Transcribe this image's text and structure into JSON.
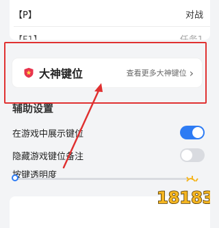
{
  "top_rows": [
    {
      "left": "【P】",
      "right": "对战"
    },
    {
      "left": "【F1】",
      "right": "任务1"
    }
  ],
  "master_keys": {
    "title": "大神键位",
    "link": "查看更多大神键位",
    "chevron": "›"
  },
  "section": {
    "title": "辅助设置"
  },
  "settings": [
    {
      "label": "在游戏中展示键位",
      "state": "on"
    },
    {
      "label": "隐藏游戏键位备注",
      "state": "off"
    }
  ],
  "opacity": {
    "label": "按键透明度",
    "value": 0
  },
  "watermark": {
    "text": "18183"
  },
  "colors": {
    "accent": "#2d7bf4",
    "annotation": "#e03030"
  }
}
